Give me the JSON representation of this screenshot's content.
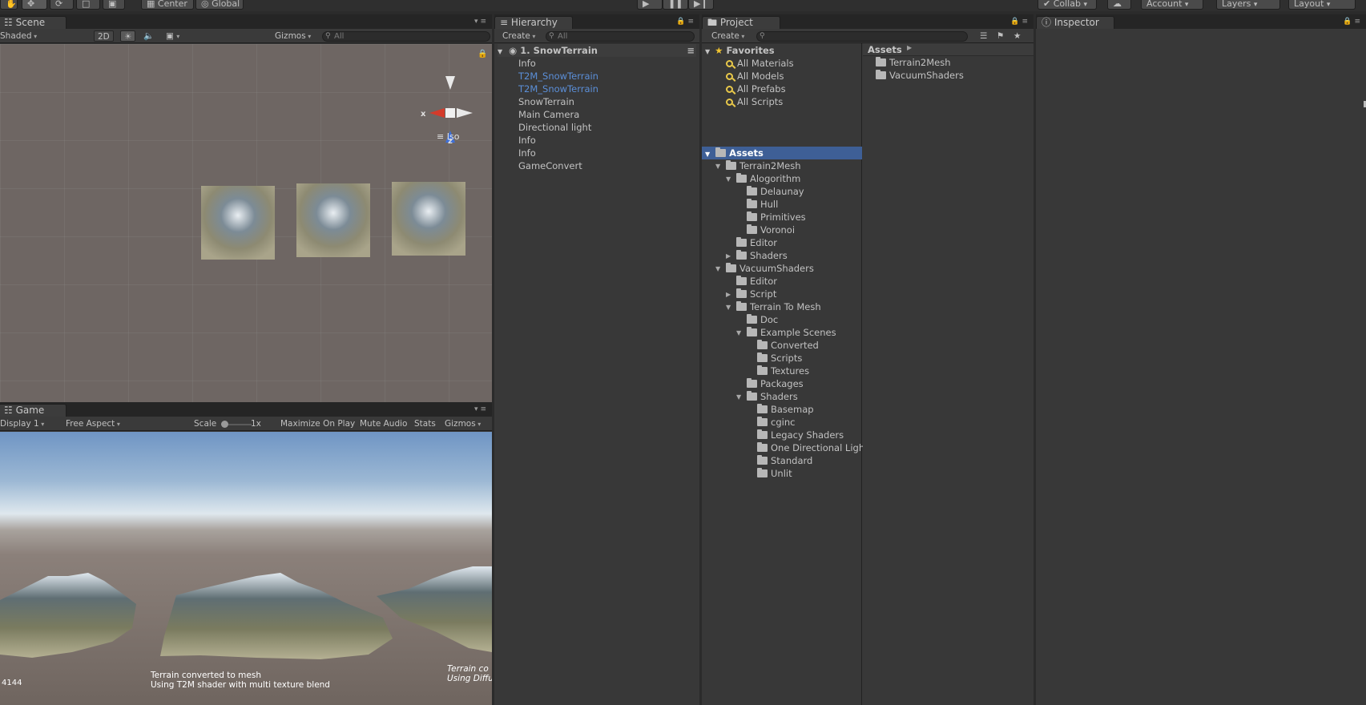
{
  "toolbar": {
    "center_label": "Center",
    "global_label": "Global",
    "collab_label": "Collab",
    "account_label": "Account",
    "layers_label": "Layers",
    "layout_label": "Layout"
  },
  "scene": {
    "tab_label": "Scene",
    "shading_mode": "Shaded",
    "mode_2d": "2D",
    "gizmos_label": "Gizmos",
    "search_placeholder": "All",
    "gizmo_x": "x",
    "gizmo_z": "z",
    "projection_label": "Iso"
  },
  "game": {
    "tab_label": "Game",
    "display": "Display 1",
    "aspect": "Free Aspect",
    "scale_label": "Scale",
    "scale_value": "1x",
    "maximize_label": "Maximize On Play",
    "mute_label": "Mute Audio",
    "stats_label": "Stats",
    "gizmos_label": "Gizmos",
    "caption_line1": "Terrain converted to mesh",
    "caption_line2": "Using T2M shader with multi texture blend",
    "caption_right1": "Terrain co",
    "caption_right2": "Using Diffu",
    "fps_text": "4144"
  },
  "hierarchy": {
    "tab_label": "Hierarchy",
    "create_label": "Create",
    "search_placeholder": "All",
    "scene_name": "1. SnowTerrain",
    "items": [
      {
        "label": "Info",
        "highlight": false
      },
      {
        "label": "T2M_SnowTerrain",
        "highlight": true
      },
      {
        "label": "T2M_SnowTerrain",
        "highlight": true
      },
      {
        "label": "SnowTerrain",
        "highlight": false
      },
      {
        "label": "Main Camera",
        "highlight": false
      },
      {
        "label": "Directional light",
        "highlight": false
      },
      {
        "label": "Info",
        "highlight": false
      },
      {
        "label": "Info",
        "highlight": false
      },
      {
        "label": "GameConvert",
        "highlight": false
      }
    ]
  },
  "project": {
    "tab_label": "Project",
    "create_label": "Create",
    "favorites_label": "Favorites",
    "favorites": [
      "All Materials",
      "All Models",
      "All Prefabs",
      "All Scripts"
    ],
    "assets_root": "Assets",
    "tree": [
      {
        "label": "Terrain2Mesh",
        "depth": 1,
        "arrow": "open"
      },
      {
        "label": "Alogorithm",
        "depth": 2,
        "arrow": "open"
      },
      {
        "label": "Delaunay",
        "depth": 3,
        "arrow": "none"
      },
      {
        "label": "Hull",
        "depth": 3,
        "arrow": "none"
      },
      {
        "label": "Primitives",
        "depth": 3,
        "arrow": "none"
      },
      {
        "label": "Voronoi",
        "depth": 3,
        "arrow": "none"
      },
      {
        "label": "Editor",
        "depth": 2,
        "arrow": "none"
      },
      {
        "label": "Shaders",
        "depth": 2,
        "arrow": "closed"
      },
      {
        "label": "VacuumShaders",
        "depth": 1,
        "arrow": "open"
      },
      {
        "label": "Editor",
        "depth": 2,
        "arrow": "none"
      },
      {
        "label": "Script",
        "depth": 2,
        "arrow": "closed"
      },
      {
        "label": "Terrain To Mesh",
        "depth": 2,
        "arrow": "open"
      },
      {
        "label": "Doc",
        "depth": 3,
        "arrow": "none"
      },
      {
        "label": "Example Scenes",
        "depth": 3,
        "arrow": "open"
      },
      {
        "label": "Converted",
        "depth": 4,
        "arrow": "none"
      },
      {
        "label": "Scripts",
        "depth": 4,
        "arrow": "none"
      },
      {
        "label": "Textures",
        "depth": 4,
        "arrow": "none"
      },
      {
        "label": "Packages",
        "depth": 3,
        "arrow": "none"
      },
      {
        "label": "Shaders",
        "depth": 3,
        "arrow": "open"
      },
      {
        "label": "Basemap",
        "depth": 4,
        "arrow": "none"
      },
      {
        "label": "cginc",
        "depth": 4,
        "arrow": "none"
      },
      {
        "label": "Legacy Shaders",
        "depth": 4,
        "arrow": "none"
      },
      {
        "label": "One Directional Ligh",
        "depth": 4,
        "arrow": "none"
      },
      {
        "label": "Standard",
        "depth": 4,
        "arrow": "none"
      },
      {
        "label": "Unlit",
        "depth": 4,
        "arrow": "none"
      }
    ],
    "breadcrumb": "Assets",
    "contents": [
      "Terrain2Mesh",
      "VacuumShaders"
    ]
  },
  "inspector": {
    "tab_label": "Inspector"
  },
  "colors": {
    "selection": "#3e5f96",
    "link_blue": "#5b8fd8"
  }
}
